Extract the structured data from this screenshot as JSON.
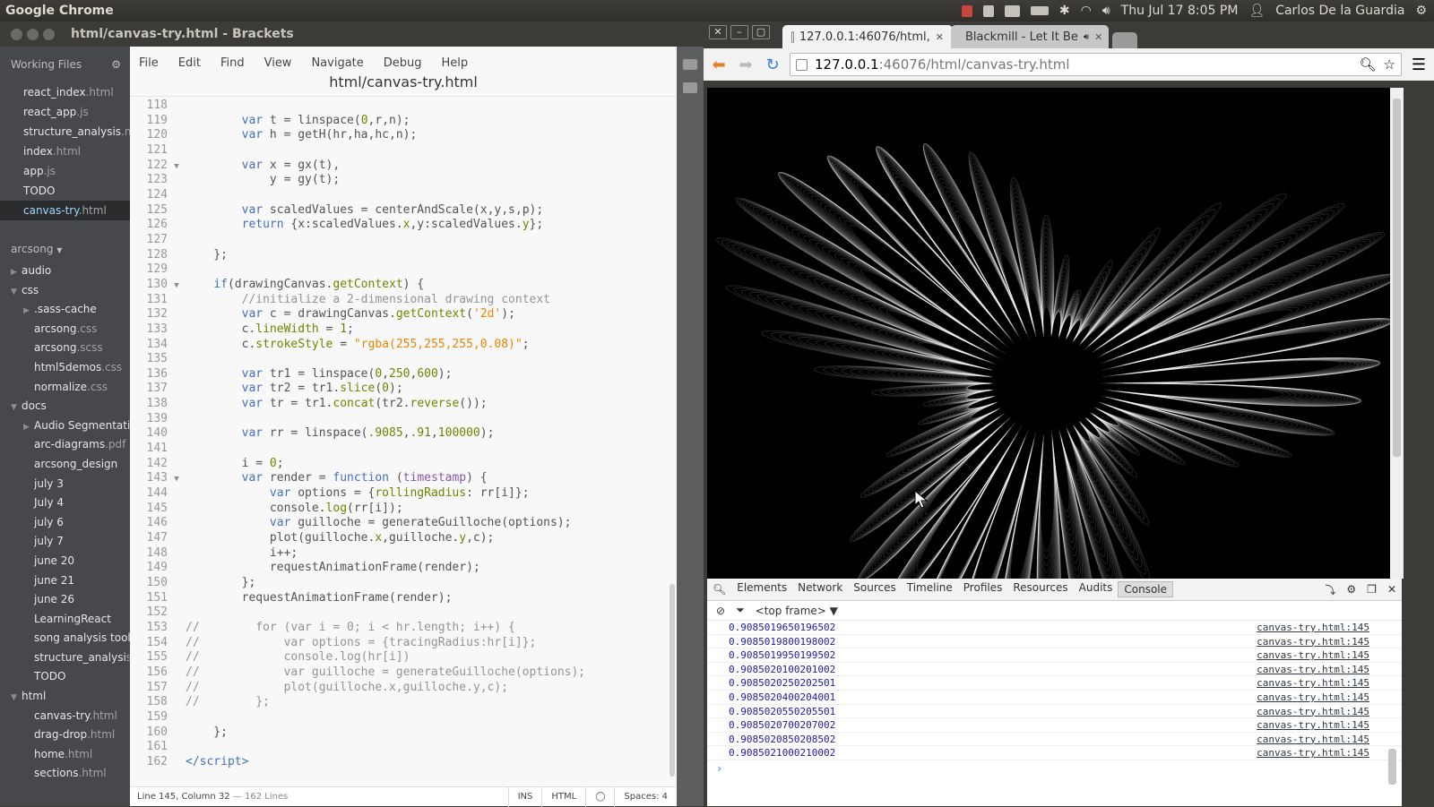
{
  "os": {
    "app_name": "Google Chrome",
    "datetime": "Thu Jul 17  8:05 PM",
    "user": "Carlos De la Guardia"
  },
  "brackets": {
    "window_title": "html/canvas-try.html - Brackets",
    "working_files_label": "Working Files",
    "working_files": [
      {
        "name": "react_index",
        "ext": ".html"
      },
      {
        "name": "react_app",
        "ext": ".js"
      },
      {
        "name": "structure_analysis",
        "ext": ".md"
      },
      {
        "name": "index",
        "ext": ".html"
      },
      {
        "name": "app",
        "ext": ".js"
      },
      {
        "name": "TODO",
        "ext": ""
      },
      {
        "name": "canvas-try",
        "ext": ".html",
        "selected": true
      }
    ],
    "project_name": "arcsong",
    "tree": [
      {
        "name": "audio",
        "ext": "",
        "level": 0,
        "arrow": "▶"
      },
      {
        "name": "css",
        "ext": "",
        "level": 0,
        "arrow": "▼"
      },
      {
        "name": ".sass-cache",
        "ext": "",
        "level": 1,
        "arrow": "▶"
      },
      {
        "name": "arcsong",
        "ext": ".css",
        "level": 1,
        "arrow": ""
      },
      {
        "name": "arcsong",
        "ext": ".scss",
        "level": 1,
        "arrow": ""
      },
      {
        "name": "html5demos",
        "ext": ".css",
        "level": 1,
        "arrow": ""
      },
      {
        "name": "normalize",
        "ext": ".css",
        "level": 1,
        "arrow": ""
      },
      {
        "name": "docs",
        "ext": "",
        "level": 0,
        "arrow": "▼"
      },
      {
        "name": "Audio Segmentati",
        "ext": "",
        "level": 1,
        "arrow": "▶"
      },
      {
        "name": "arc-diagrams",
        "ext": ".pdf",
        "level": 1,
        "arrow": ""
      },
      {
        "name": "arcsong_design",
        "ext": "",
        "level": 1,
        "arrow": ""
      },
      {
        "name": "july 3",
        "ext": "",
        "level": 1,
        "arrow": ""
      },
      {
        "name": "July 4",
        "ext": "",
        "level": 1,
        "arrow": ""
      },
      {
        "name": "july 6",
        "ext": "",
        "level": 1,
        "arrow": ""
      },
      {
        "name": "july 7",
        "ext": "",
        "level": 1,
        "arrow": ""
      },
      {
        "name": "june 20",
        "ext": "",
        "level": 1,
        "arrow": ""
      },
      {
        "name": "june 21",
        "ext": "",
        "level": 1,
        "arrow": ""
      },
      {
        "name": "june 26",
        "ext": "",
        "level": 1,
        "arrow": ""
      },
      {
        "name": "LearningReact",
        "ext": "",
        "level": 1,
        "arrow": ""
      },
      {
        "name": "song analysis tool",
        "ext": "",
        "level": 1,
        "arrow": ""
      },
      {
        "name": "structure_analysi",
        "ext": "s",
        "level": 1,
        "arrow": ""
      },
      {
        "name": "TODO",
        "ext": "",
        "level": 1,
        "arrow": ""
      },
      {
        "name": "html",
        "ext": "",
        "level": 0,
        "arrow": "▼"
      },
      {
        "name": "canvas-try",
        "ext": ".html",
        "level": 1,
        "arrow": ""
      },
      {
        "name": "drag-drop",
        "ext": ".html",
        "level": 1,
        "arrow": ""
      },
      {
        "name": "home",
        "ext": ".html",
        "level": 1,
        "arrow": ""
      },
      {
        "name": "sections",
        "ext": ".html",
        "level": 1,
        "arrow": ""
      }
    ],
    "menu": [
      "File",
      "Edit",
      "Find",
      "View",
      "Navigate",
      "Debug",
      "Help"
    ],
    "file_title": "html/canvas-try.html",
    "code_lines": [
      {
        "n": "118",
        "h": ""
      },
      {
        "n": "119",
        "h": "        <kw>var</kw> t = linspace(<num>0</num>,r,n);"
      },
      {
        "n": "120",
        "h": "        <kw>var</kw> h = getH(hr,ha,hc,n);"
      },
      {
        "n": "121",
        "h": ""
      },
      {
        "n": "122",
        "h": "        <kw>var</kw> x = gx(t),",
        "fold": true
      },
      {
        "n": "123",
        "h": "            y = gy(t);"
      },
      {
        "n": "124",
        "h": ""
      },
      {
        "n": "125",
        "h": "        <kw>var</kw> scaledValues = centerAndScale(x,y,s,p);"
      },
      {
        "n": "126",
        "h": "        <kw>return</kw> {x:scaledValues.<pr>x</pr>,y:scaledValues.<pr>y</pr>};"
      },
      {
        "n": "127",
        "h": ""
      },
      {
        "n": "128",
        "h": "    };"
      },
      {
        "n": "129",
        "h": ""
      },
      {
        "n": "130",
        "h": "    <kw>if</kw>(drawingCanvas.<pr>getContext</pr>) {",
        "fold": true
      },
      {
        "n": "131",
        "h": "        <cm>//initialize a 2-dimensional drawing context</cm>"
      },
      {
        "n": "132",
        "h": "        <kw>var</kw> c = drawingCanvas.<pr>getContext</pr>(<str>'2d'</str>);"
      },
      {
        "n": "133",
        "h": "        c.<pr>lineWidth</pr> = <num>1</num>;"
      },
      {
        "n": "134",
        "h": "        c.<pr>strokeStyle</pr> = <str>\"rgba(255,255,255,0.08)\"</str>;"
      },
      {
        "n": "135",
        "h": ""
      },
      {
        "n": "136",
        "h": "        <kw>var</kw> tr1 = linspace(<num>0</num>,<num>250</num>,<num>600</num>);"
      },
      {
        "n": "137",
        "h": "        <kw>var</kw> tr2 = tr1.<pr>slice</pr>(<num>0</num>);"
      },
      {
        "n": "138",
        "h": "        <kw>var</kw> tr = tr1.<pr>concat</pr>(tr2.<pr>reverse</pr>());"
      },
      {
        "n": "139",
        "h": ""
      },
      {
        "n": "140",
        "h": "        <kw>var</kw> rr = linspace(<num>.9085</num>,<num>.91</num>,<num>100000</num>);"
      },
      {
        "n": "141",
        "h": ""
      },
      {
        "n": "142",
        "h": "        i = <num>0</num>;"
      },
      {
        "n": "143",
        "h": "        <kw>var</kw> render = <kw>function</kw> (<fn>timestamp</fn>) {",
        "fold": true
      },
      {
        "n": "144",
        "h": "            <kw>var</kw> options = {<pr>rollingRadius</pr>: rr[i]};"
      },
      {
        "n": "145",
        "h": "            console.<pr>log</pr>(rr[i]);"
      },
      {
        "n": "146",
        "h": "            <kw>var</kw> guilloche = generateGuilloche(options);"
      },
      {
        "n": "147",
        "h": "            plot(guilloche.<pr>x</pr>,guilloche.<pr>y</pr>,c);"
      },
      {
        "n": "148",
        "h": "            i++;"
      },
      {
        "n": "149",
        "h": "            requestAnimationFrame(render);"
      },
      {
        "n": "150",
        "h": "        };"
      },
      {
        "n": "151",
        "h": "        requestAnimationFrame(render);"
      },
      {
        "n": "152",
        "h": ""
      },
      {
        "n": "153",
        "h": "<cm>//        for (var i = 0; i < hr.length; i++) {</cm>"
      },
      {
        "n": "154",
        "h": "<cm>//            var options = {tracingRadius:hr[i]};</cm>"
      },
      {
        "n": "155",
        "h": "<cm>//            console.log(hr[i])</cm>"
      },
      {
        "n": "156",
        "h": "<cm>//            var guilloche = generateGuilloche(options);</cm>"
      },
      {
        "n": "157",
        "h": "<cm>//            plot(guilloche.x,guilloche.y,c);</cm>"
      },
      {
        "n": "158",
        "h": "<cm>//        };</cm>"
      },
      {
        "n": "159",
        "h": ""
      },
      {
        "n": "160",
        "h": "    };"
      },
      {
        "n": "161",
        "h": ""
      },
      {
        "n": "162",
        "h": "<tg>&lt;/script&gt;</tg>"
      }
    ],
    "status": {
      "cursor": "Line 145, Column 32",
      "lines": "— 162 Lines",
      "mode": "INS",
      "language": "HTML",
      "spaces": "Spaces: 4"
    }
  },
  "chrome": {
    "tabs": [
      {
        "title": "127.0.0.1:46076/html,",
        "active": true
      },
      {
        "title": "Blackmill - Let It Be",
        "active": false
      }
    ],
    "url_host": "127.0.0.1",
    "url_path": ":46076/html/canvas-try.html",
    "devtools": {
      "tabs": [
        "Elements",
        "Network",
        "Sources",
        "Timeline",
        "Profiles",
        "Resources",
        "Audits",
        "Console"
      ],
      "selected_tab": "Console",
      "frame": "<top frame>",
      "rows": [
        "0.9085019650196502",
        "0.9085019800198002",
        "0.9085019950199502",
        "0.9085020100201002",
        "0.9085020250202501",
        "0.9085020400204001",
        "0.9085020550205501",
        "0.9085020700207002",
        "0.9085020850208502",
        "0.9085021000210002"
      ],
      "source": "canvas-try.html:145",
      "prompt": "›"
    }
  },
  "icon_names": [
    "battery-icon",
    "bluetooth-icon",
    "wifi-icon",
    "volume-icon",
    "mail-icon",
    "chat-icon",
    "settings-gear-icon",
    "back-arrow-icon",
    "forward-arrow-icon",
    "reload-icon",
    "search-icon",
    "star-icon",
    "menu-icon"
  ]
}
